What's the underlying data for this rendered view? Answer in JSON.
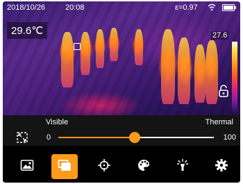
{
  "status_bar": {
    "date": "2018/10/26",
    "time": "20:08",
    "emissivity": "ε=0.97"
  },
  "thermal_view": {
    "center_temperature": "29.6℃",
    "scale_max": "27.6"
  },
  "blend_slider": {
    "left_label": "Visible",
    "right_label": "Thermal",
    "min": "0",
    "max": "100",
    "value_percent": 49
  },
  "toolbar": {
    "buttons": [
      {
        "icon": "image-icon",
        "active": false
      },
      {
        "icon": "picture-in-picture-icon",
        "active": true
      },
      {
        "icon": "crosshair-icon",
        "active": false
      },
      {
        "icon": "palette-icon",
        "active": false
      },
      {
        "icon": "flashlight-icon",
        "active": false
      },
      {
        "icon": "gear-icon",
        "active": false
      }
    ]
  },
  "colors": {
    "accent": "#ff9a1a"
  }
}
